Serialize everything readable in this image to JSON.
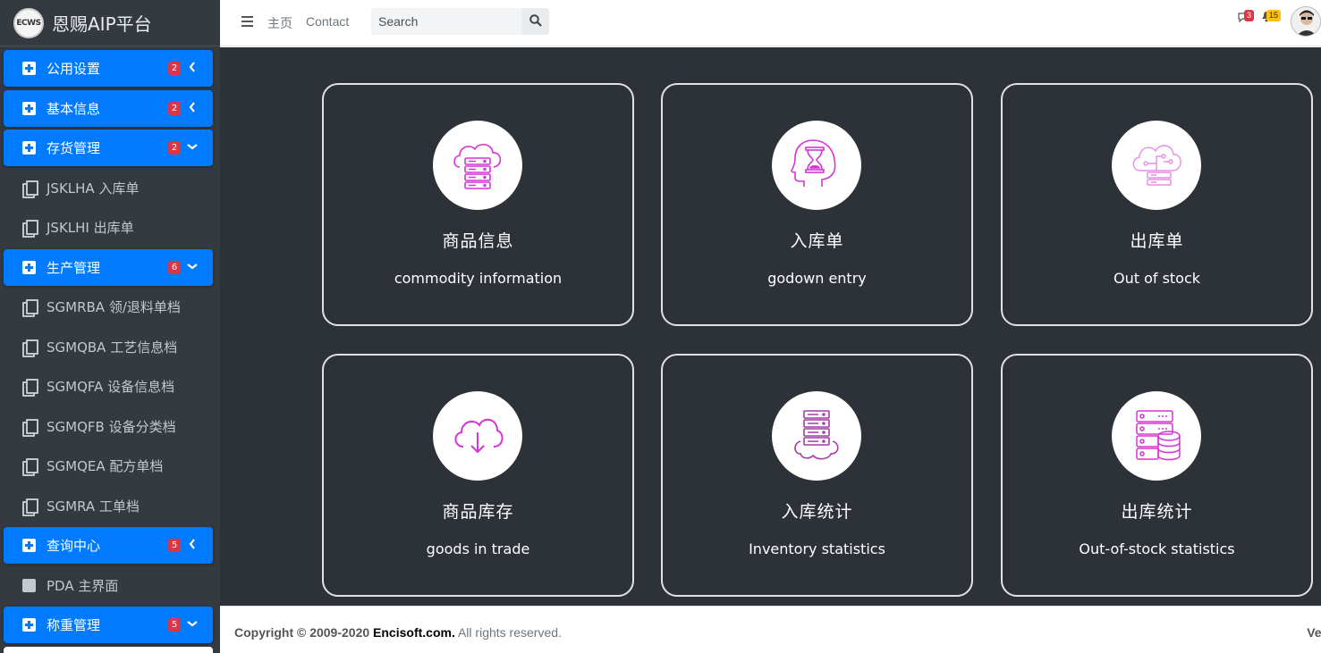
{
  "brand": {
    "logo_text": "ECWS",
    "name": "恩赐AIP平台"
  },
  "sidebar": {
    "items": [
      {
        "label": "公用设置",
        "type": "group",
        "badge": "2",
        "chevron": "left"
      },
      {
        "label": "基本信息",
        "type": "group",
        "badge": "2",
        "chevron": "left"
      },
      {
        "label": "存货管理",
        "type": "group",
        "badge": "2",
        "chevron": "down"
      },
      {
        "label": "JSKLHA 入库单",
        "type": "page"
      },
      {
        "label": "JSKLHI 出库单",
        "type": "page"
      },
      {
        "label": "生产管理",
        "type": "group",
        "badge": "6",
        "chevron": "down"
      },
      {
        "label": "SGMRBA 领/退料单档",
        "type": "page"
      },
      {
        "label": "SGMQBA 工艺信息档",
        "type": "page"
      },
      {
        "label": "SGMQFA 设备信息档",
        "type": "page"
      },
      {
        "label": "SGMQFB 设备分类档",
        "type": "page"
      },
      {
        "label": "SGMQEA 配方单档",
        "type": "page"
      },
      {
        "label": "SGMRA 工单档",
        "type": "page"
      },
      {
        "label": "查询中心",
        "type": "group",
        "badge": "5",
        "chevron": "left"
      },
      {
        "label": "PDA 主界面",
        "type": "square"
      },
      {
        "label": "称重管理",
        "type": "group",
        "badge": "5",
        "chevron": "down"
      }
    ]
  },
  "header": {
    "home_label": "主页",
    "contact_label": "Contact",
    "search_placeholder": "Search",
    "messages_count": "3",
    "notifications_count": "15"
  },
  "cards": [
    {
      "title": "商品信息",
      "subtitle": "commodity information",
      "icon": "cloud-server-icon"
    },
    {
      "title": "入库单",
      "subtitle": "godown entry",
      "icon": "head-hourglass-icon"
    },
    {
      "title": "出库单",
      "subtitle": "Out of stock",
      "icon": "cloud-network-icon"
    },
    {
      "title": "商品库存",
      "subtitle": "goods in trade",
      "icon": "cloud-download-icon"
    },
    {
      "title": "入库统计",
      "subtitle": "Inventory statistics",
      "icon": "server-cloud-icon"
    },
    {
      "title": "出库统计",
      "subtitle": "Out-of-stock statistics",
      "icon": "server-database-icon"
    }
  ],
  "footer": {
    "copyright_prefix": "Copyright © 2009-2020",
    "company": "Encisoft.com.",
    "rights": "All rights reserved.",
    "version_label": "Ver"
  },
  "colors": {
    "accent": "#007bff",
    "sidebar_bg": "#343a40",
    "main_bg": "#2d3238",
    "icon_magenta": "#d633d6",
    "badge_red": "#dc3545",
    "badge_yellow": "#ffc107"
  }
}
